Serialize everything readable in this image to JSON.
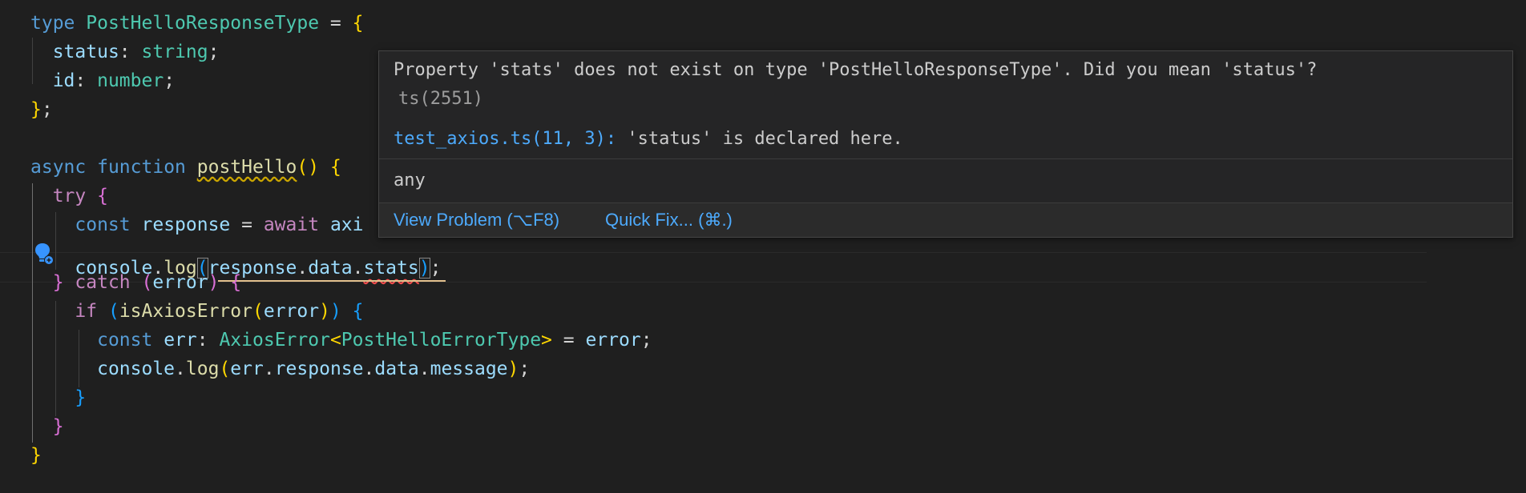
{
  "code": {
    "l1": {
      "kw": "type",
      "name": "PostHelloResponseType",
      "eq": " = ",
      "brace": "{"
    },
    "l2": {
      "prop": "status",
      "colon": ": ",
      "type": "string",
      "semi": ";"
    },
    "l3": {
      "prop": "id",
      "colon": ": ",
      "type": "number",
      "semi": ";"
    },
    "l4": {
      "brace": "}",
      "semi": ";"
    },
    "l6": {
      "kw1": "async",
      "kw2": "function",
      "fn": "postHello",
      "parens": "()",
      "brace": "{"
    },
    "l7": {
      "kw": "try",
      "brace": "{"
    },
    "l8": {
      "kw": "const",
      "var": "response",
      "eq": " = ",
      "await": "await",
      "rest": "axi"
    },
    "l9": {
      "obj": "console",
      "dot": ".",
      "fn": "log",
      "open": "(",
      "a": "response",
      "b": "data",
      "c": "stats",
      "close": ")",
      "semi": ";"
    },
    "l10": {
      "brace1": "}",
      "kw": "catch",
      "open": "(",
      "var": "error",
      "close": ")",
      "brace2": "{"
    },
    "l11": {
      "kw": "if",
      "open": "(",
      "fn": "isAxiosError",
      "open2": "(",
      "var": "error",
      "close2": ")",
      "close": ")",
      "brace": "{"
    },
    "l12": {
      "kw": "const",
      "var": "err",
      "colon": ": ",
      "type": "AxiosError",
      "lt": "<",
      "targ": "PostHelloErrorType",
      "gt": ">",
      "eq": " = ",
      "val": "error",
      "semi": ";"
    },
    "l13": {
      "obj": "console",
      "fn": "log",
      "open": "(",
      "a": "err",
      "b": "response",
      "c": "data",
      "d": "message",
      "close": ")",
      "semi": ";"
    },
    "l14": {
      "brace": "}"
    },
    "l15": {
      "brace": "}"
    },
    "l16": {
      "brace": "}"
    }
  },
  "hover": {
    "message": "Property 'stats' does not exist on type 'PostHelloResponseType'. Did you mean 'status'?",
    "code": "ts(2551)",
    "related_location": "test_axios.ts(11, 3):",
    "related_text": " 'status' is declared here.",
    "type_info": "any",
    "view_problem": "View Problem (⌥F8)",
    "quick_fix": "Quick Fix... (⌘.)"
  },
  "colors": {
    "background": "#1f1f1f",
    "hover_background": "#252526",
    "link": "#4daafc",
    "error_squiggle": "#f14c4c",
    "warning_squiggle": "#cca700",
    "lightbulb": "#3794ff"
  },
  "icons": [
    "lightbulb-autofix-icon"
  ]
}
